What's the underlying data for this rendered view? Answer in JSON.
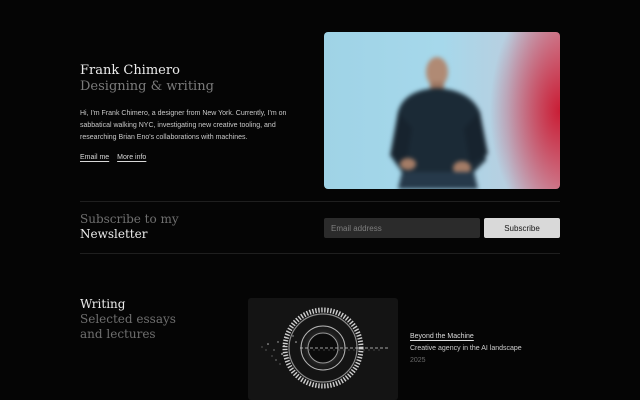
{
  "hero": {
    "name": "Frank Chimero",
    "tagline": "Designing & writing",
    "bio": "Hi, I'm Frank Chimero, a designer from New York. Currently, I'm on sabbatical walking NYC, investigating new creative tooling, and researching Brian Eno's collaborations with machines.",
    "links": {
      "email": "Email me",
      "more": "More info"
    }
  },
  "newsletter": {
    "line1": "Subscribe to my",
    "line2": "Newsletter",
    "email_placeholder": "Email address",
    "button": "Subscribe"
  },
  "writing": {
    "title": "Writing",
    "subtitle_line1": "Selected essays",
    "subtitle_line2": "and lectures",
    "featured": {
      "title": "Beyond the Machine",
      "description": "Creative agency in the AI landscape",
      "year": "2025"
    }
  },
  "colors": {
    "background": "#050505",
    "muted_text": "#6f6f6f",
    "button_bg": "#d9d9d9",
    "photo_accent": "#c91d35"
  }
}
